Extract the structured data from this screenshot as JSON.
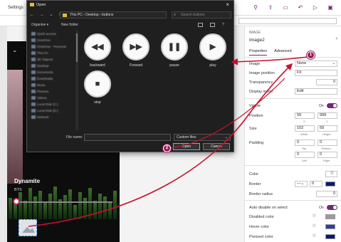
{
  "app": {
    "title": "Settings"
  },
  "colors": {
    "accent": "#742774",
    "annotation": "#c8102e",
    "dialog_bg": "#1f1f1f"
  },
  "dialog": {
    "title": "Open",
    "address": "This PC  ›  Desktop  ›  buttons",
    "search_placeholder": "Search buttons",
    "organise": "Organise ▾",
    "new_folder": "New folder",
    "nav_items": [
      "Quick access",
      "OneDrive",
      "OneDrive - Personal",
      "This PC",
      "3D Objects",
      "Desktop",
      "Documents",
      "Downloads",
      "Music",
      "Pictures",
      "Videos",
      "Local Disk (C:)",
      "Local Disk (D:)",
      "Network"
    ],
    "files": [
      {
        "label": "backward",
        "icon": "backward-icon",
        "glyph": "◀◀"
      },
      {
        "label": "Forward",
        "icon": "forward-icon",
        "glyph": "▶▶"
      },
      {
        "label": "pause",
        "icon": "pause-icon",
        "glyph": "❚❚"
      },
      {
        "label": "play",
        "icon": "play-icon",
        "glyph": "▶"
      },
      {
        "label": "stop",
        "icon": "stop-icon",
        "glyph": "■"
      }
    ],
    "file_name_label": "File name:",
    "file_type": "Custom files",
    "open_button": "Open",
    "cancel_button": "Cancel"
  },
  "canvas": {
    "song_title": "Dynamite",
    "artist": "BTS"
  },
  "props": {
    "caption": "IMAGE",
    "name": "Image2",
    "tabs": [
      "Properties",
      "Advanced"
    ],
    "image_label": "Image",
    "image_value": "None",
    "image_position_label": "Image position",
    "image_position_value": "Fit",
    "transparency_label": "Transparency",
    "transparency_value": "0",
    "display_mode_label": "Display mode",
    "display_mode_value": "Edit",
    "visible_label": "Visible",
    "visible_state": "On",
    "position_label": "Position",
    "pos_x": "59",
    "pos_y": "999",
    "pos_sub_x": "X",
    "pos_sub_y": "Y",
    "size_label": "Size",
    "size_w": "102",
    "size_h": "69",
    "size_sub_w": "Width",
    "size_sub_h": "Height",
    "padding_label": "Padding",
    "pad_top": "0",
    "pad_bottom": "0",
    "pad_left": "0",
    "pad_right": "0",
    "pad_sub_top": "Top",
    "pad_sub_bottom": "Bottom",
    "pad_sub_left": "Left",
    "pad_sub_right": "Right",
    "color_label": "Color",
    "border_label": "Border",
    "border_width": "0",
    "border_radius_label": "Border radius",
    "border_radius_value": "0",
    "auto_disable_label": "Auto disable on select",
    "auto_disable_state": "On",
    "disabled_color_label": "Disabled color",
    "hover_color_label": "Hover color",
    "pressed_color_label": "Pressed color"
  },
  "markers": {
    "one": "1",
    "two": "2"
  }
}
